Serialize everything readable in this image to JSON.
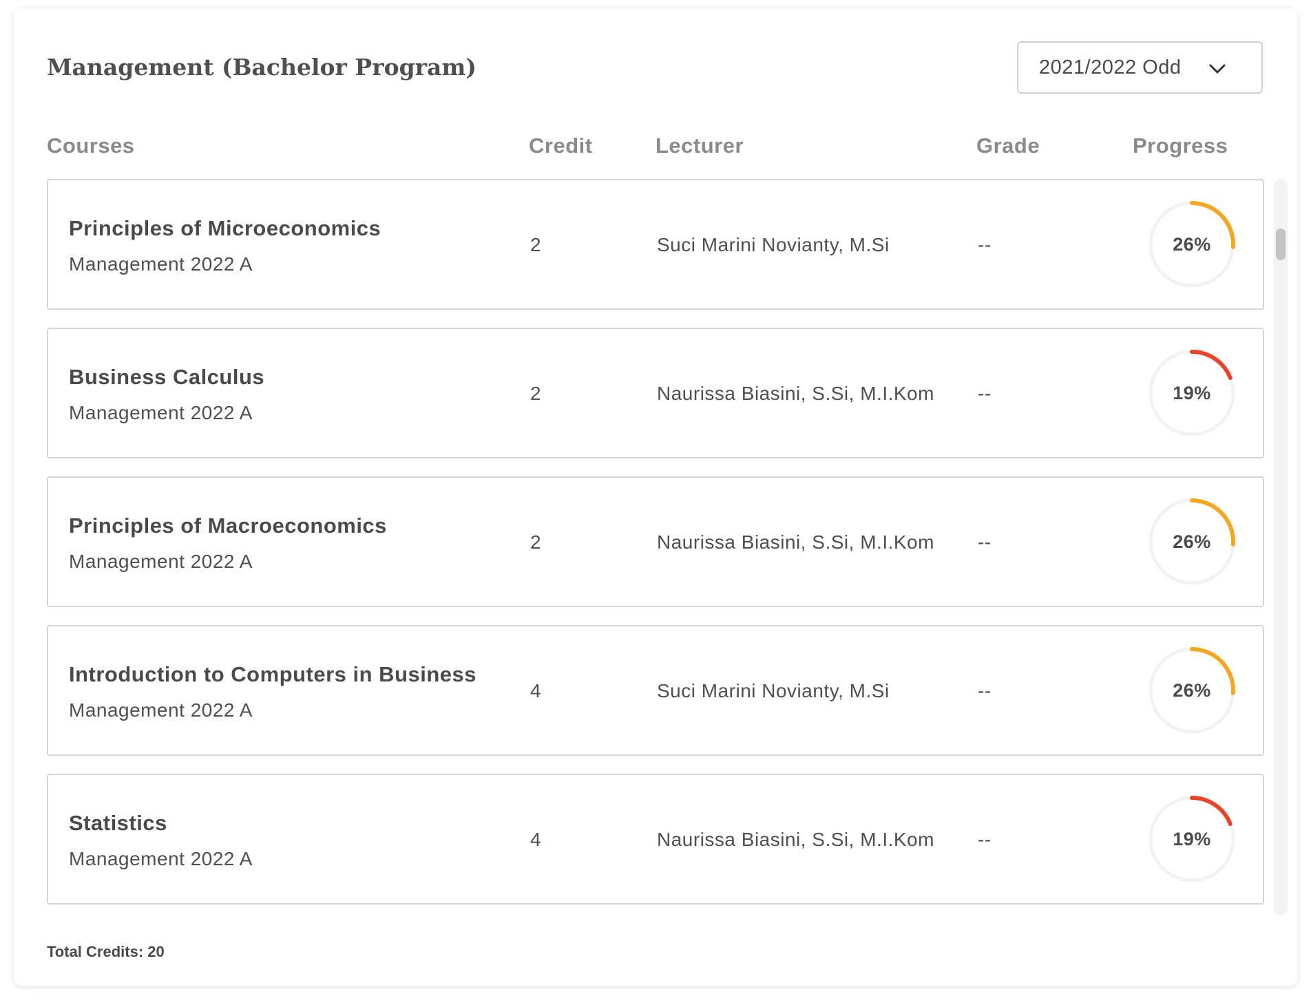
{
  "header": {
    "title": "Management (Bachelor Program)",
    "term_select": {
      "value": "2021/2022 Odd",
      "icon": "chevron-down-icon"
    }
  },
  "columns": {
    "courses": "Courses",
    "credit": "Credit",
    "lecturer": "Lecturer",
    "grade": "Grade",
    "progress": "Progress"
  },
  "courses": [
    {
      "name": "Principles of Microeconomics",
      "class": "Management 2022 A",
      "credit": "2",
      "lecturer": "Suci Marini Novianty, M.Si",
      "grade": "--",
      "progress_label": "26%",
      "progress_value": 26,
      "ring_color": "#f5a623"
    },
    {
      "name": "Business Calculus",
      "class": "Management 2022 A",
      "credit": "2",
      "lecturer": "Naurissa Biasini, S.Si, M.I.Kom",
      "grade": "--",
      "progress_label": "19%",
      "progress_value": 19,
      "ring_color": "#e8442a"
    },
    {
      "name": "Principles of Macroeconomics",
      "class": "Management 2022 A",
      "credit": "2",
      "lecturer": "Naurissa Biasini, S.Si, M.I.Kom",
      "grade": "--",
      "progress_label": "26%",
      "progress_value": 26,
      "ring_color": "#f5a623"
    },
    {
      "name": "Introduction to Computers in Business",
      "class": "Management 2022 A",
      "credit": "4",
      "lecturer": "Suci Marini Novianty, M.Si",
      "grade": "--",
      "progress_label": "26%",
      "progress_value": 26,
      "ring_color": "#f5a623"
    },
    {
      "name": "Statistics",
      "class": "Management 2022 A",
      "credit": "4",
      "lecturer": "Naurissa Biasini, S.Si, M.I.Kom",
      "grade": "--",
      "progress_label": "19%",
      "progress_value": 19,
      "ring_color": "#e8442a"
    }
  ],
  "footer": {
    "total_credits": "Total Credits: 20"
  },
  "colors": {
    "ring_track": "#f2f2f2",
    "border": "#d6d6d6"
  }
}
